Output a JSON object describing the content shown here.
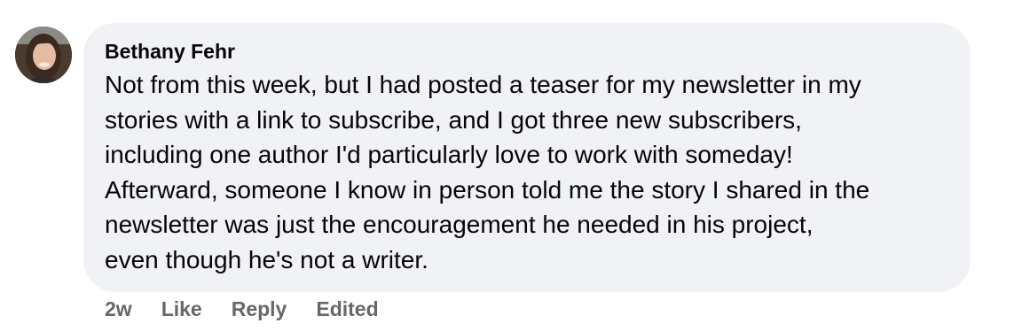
{
  "comment": {
    "author": "Bethany Fehr",
    "text": "Not from this week, but I had posted a teaser for my newsletter in my\nstories with a link to subscribe, and I got three new subscribers,\nincluding one author I'd particularly love to work with someday!\nAfterward, someone I know in person told me the story I shared in the\nnewsletter was just the encouragement he needed in his project,\neven though he's not a writer.",
    "avatar_icon": "profile-photo",
    "bubble_color": "#f0f2f5",
    "action_color": "#65676b"
  },
  "actions": {
    "timestamp": "2w",
    "like_label": "Like",
    "reply_label": "Reply",
    "edited_label": "Edited"
  }
}
